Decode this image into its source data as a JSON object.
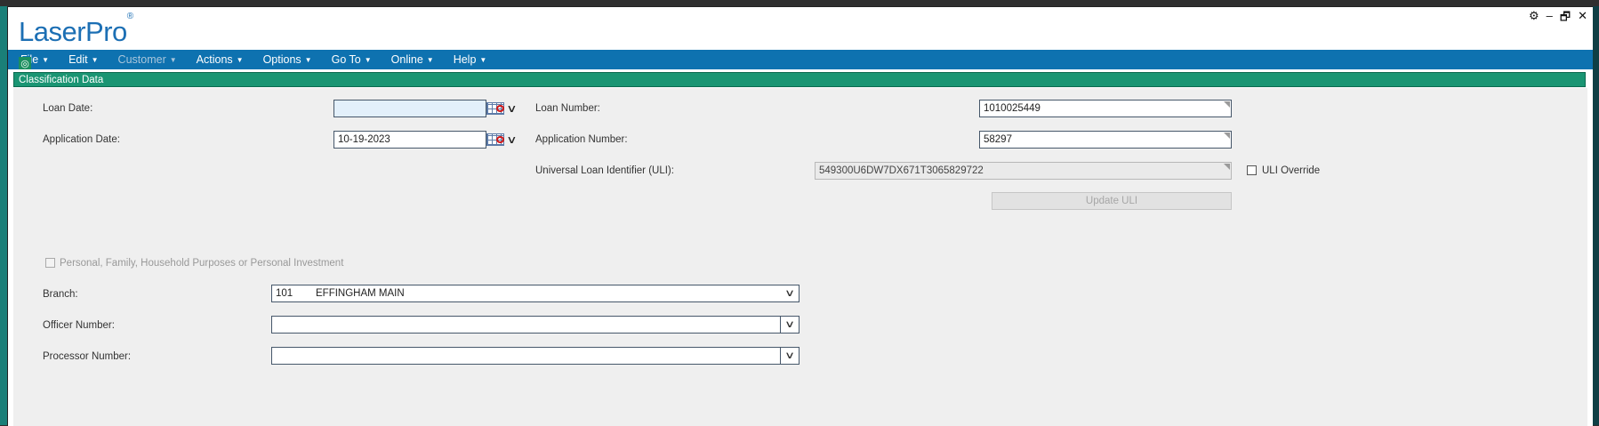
{
  "app": {
    "brand": "LaserPro",
    "brand_mark": "®"
  },
  "window_controls": {
    "settings": "⚙",
    "minimize": "–",
    "restore": "🗗",
    "close": "✕"
  },
  "menu": {
    "items": [
      {
        "label": "File",
        "enabled": true
      },
      {
        "label": "Edit",
        "enabled": true
      },
      {
        "label": "Customer",
        "enabled": false
      },
      {
        "label": "Actions",
        "enabled": true
      },
      {
        "label": "Options",
        "enabled": true
      },
      {
        "label": "Go To",
        "enabled": true
      },
      {
        "label": "Online",
        "enabled": true
      },
      {
        "label": "Help",
        "enabled": true
      }
    ]
  },
  "section": {
    "title": "Classification Data"
  },
  "form": {
    "loan_date": {
      "label": "Loan Date:",
      "value": ""
    },
    "application_date": {
      "label": "Application Date:",
      "value": "10-19-2023"
    },
    "loan_number": {
      "label": "Loan Number:",
      "value": "1010025449"
    },
    "application_number": {
      "label": "Application Number:",
      "value": "58297"
    },
    "uli": {
      "label": "Universal Loan Identifier (ULI):",
      "value": "549300U6DW7DX671T3065829722"
    },
    "uli_override": {
      "label": "ULI Override",
      "checked": false
    },
    "update_uli": {
      "label": "Update ULI",
      "enabled": false
    },
    "personal_purpose": {
      "label": "Personal, Family, Household Purposes or Personal Investment",
      "checked": false,
      "enabled": false
    },
    "branch": {
      "label": "Branch:",
      "code": "101",
      "name": "EFFINGHAM MAIN"
    },
    "officer_number": {
      "label": "Officer Number:",
      "value": ""
    },
    "processor_number": {
      "label": "Processor Number:",
      "value": ""
    }
  },
  "colors": {
    "menubar": "#0e72b0",
    "section_header": "#1a9573",
    "brand": "#1c6fb4"
  }
}
